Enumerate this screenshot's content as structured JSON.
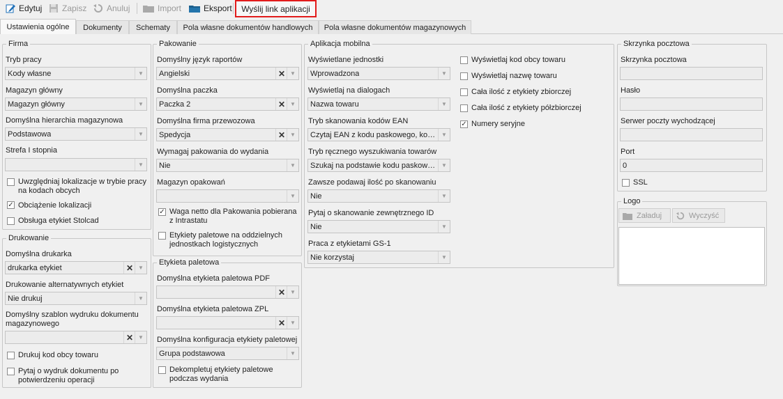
{
  "toolbar": {
    "edit": "Edytuj",
    "save": "Zapisz",
    "cancel": "Anuluj",
    "import": "Import",
    "export": "Eksport",
    "send_link": "Wyślij link aplikacji"
  },
  "tabs": [
    "Ustawienia ogólne",
    "Dokumenty",
    "Schematy",
    "Pola własne dokumentów handlowych",
    "Pola własne dokumentów magazynowych"
  ],
  "firma": {
    "title": "Firma",
    "tryb_pracy_label": "Tryb pracy",
    "tryb_pracy_value": "Kody własne",
    "magazyn_label": "Magazyn główny",
    "magazyn_value": "Magazyn główny",
    "hierarchia_label": "Domyślna hierarchia magazynowa",
    "hierarchia_value": "Podstawowa",
    "strefa_label": "Strefa I stopnia",
    "strefa_value": "",
    "chk1_label": "Uwzględniaj lokalizacje w trybie pracy na kodach obcych",
    "chk1_checked": false,
    "chk2_label": "Obciążenie lokalizacji",
    "chk2_checked": true,
    "chk3_label": "Obsługa etykiet Stolcad",
    "chk3_checked": false
  },
  "drukowanie": {
    "title": "Drukowanie",
    "drukarka_label": "Domyślna drukarka",
    "drukarka_value": "drukarka etykiet",
    "alt_label": "Drukowanie alternatywnych etykiet",
    "alt_value": "Nie drukuj",
    "szablon_label": "Domyślny szablon wydruku dokumentu magazynowego",
    "szablon_value": "",
    "chk1_label": "Drukuj kod obcy towaru",
    "chk1_checked": false,
    "chk2_label": "Pytaj o wydruk dokumentu po potwierdzeniu operacji",
    "chk2_checked": false
  },
  "pakowanie": {
    "title": "Pakowanie",
    "jezyk_label": "Domyślny język raportów",
    "jezyk_value": "Angielski",
    "paczka_label": "Domyślna paczka",
    "paczka_value": "Paczka 2",
    "firma_label": "Domyślna firma przewozowa",
    "firma_value": "Spedycja",
    "wymagaj_label": "Wymagaj pakowania do wydania",
    "wymagaj_value": "Nie",
    "magazyn_label": "Magazyn opakowań",
    "magazyn_value": "",
    "chk1_label": "Waga netto dla Pakowania pobierana z Intrastatu",
    "chk1_checked": true,
    "chk2_label": "Etykiety paletowe na oddzielnych jednostkach logistycznych",
    "chk2_checked": false
  },
  "etykieta": {
    "title": "Etykieta paletowa",
    "pdf_label": "Domyślna etykieta paletowa PDF",
    "pdf_value": "",
    "zpl_label": "Domyślna etykieta paletowa ZPL",
    "zpl_value": "",
    "konf_label": "Domyślna konfiguracja etykiety paletowej",
    "konf_value": "Grupa podstawowa",
    "chk1_label": "Dekompletuj etykiety paletowe podczas wydania",
    "chk1_checked": false
  },
  "aplikacja": {
    "title": "Aplikacja mobilna",
    "jednostki_label": "Wyświetlane jednostki",
    "jednostki_value": "Wprowadzona",
    "dialogi_label": "Wyświetlaj na dialogach",
    "dialogi_value": "Nazwa towaru",
    "ean_label": "Tryb skanowania kodów EAN",
    "ean_value": "Czytaj EAN z kodu paskowego, kod...",
    "reczny_label": "Tryb ręcznego wyszukiwania towarów",
    "reczny_value": "Szukaj na podstawie kodu paskowe...",
    "ilosc_label": "Zawsze podawaj ilość po skanowaniu",
    "ilosc_value": "Nie",
    "zewn_label": "Pytaj o skanowanie zewnętrznego ID",
    "zewn_value": "Nie",
    "gs1_label": "Praca z etykietami GS-1",
    "gs1_value": "Nie korzystaj",
    "c1_label": "Wyświetlaj kod obcy towaru",
    "c1_checked": false,
    "c2_label": "Wyświetlaj nazwę towaru",
    "c2_checked": false,
    "c3_label": "Cała ilość z etykiety zbiorczej",
    "c3_checked": false,
    "c4_label": "Cała ilość z etykiety półzbiorczej",
    "c4_checked": false,
    "c5_label": "Numery seryjne",
    "c5_checked": true
  },
  "skrzynka": {
    "title": "Skrzynka pocztowa",
    "skrzynka_label": "Skrzynka pocztowa",
    "skrzynka_value": "",
    "haslo_label": "Hasło",
    "haslo_value": "",
    "serwer_label": "Serwer poczty wychodzącej",
    "serwer_value": "",
    "port_label": "Port",
    "port_value": "0",
    "ssl_label": "SSL",
    "ssl_checked": false
  },
  "logo": {
    "title": "Logo",
    "upload_label": "Załaduj",
    "clear_label": "Wyczyść"
  },
  "colors": {
    "highlight": "#e21b1b",
    "accent_blue": "#1e6fb8"
  }
}
